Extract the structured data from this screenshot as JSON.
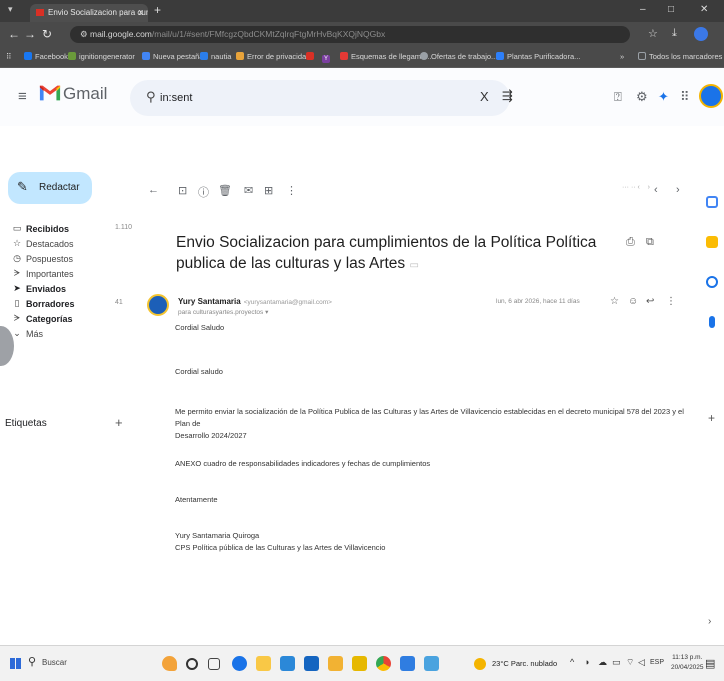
{
  "browser": {
    "tab_title": "Envio Socializacion para cumpl",
    "tab_close": "x",
    "tab_new": "+",
    "url_host": "mail.google.com",
    "url_path": "/mail/u/1/#sent/FMfcgzQbdCKMtZqlrqFtgMrHvBqKXQjNQGbx",
    "window_controls": [
      "–",
      "□",
      "✕"
    ]
  },
  "bookmarks": [
    {
      "label": "Facebook",
      "color": "#1877f2"
    },
    {
      "label": "ignitiongenerator",
      "color": "#6a9a3a"
    },
    {
      "label": "Nueva pestaña",
      "color": "#4285f4"
    },
    {
      "label": "nautia",
      "color": "#2b7de9"
    },
    {
      "label": "Error de privacidad",
      "color": "#e8a33a"
    },
    {
      "label": "",
      "color": "#d93025"
    },
    {
      "label": "Y",
      "color": "#7b3fa0"
    },
    {
      "label": "Esquemas de llegame...",
      "color": "#e53935"
    },
    {
      "label": "Ofertas de trabajo...",
      "color": "#9aa0a6"
    },
    {
      "label": "Plantas Purificadora...",
      "color": "#2d7ff9"
    },
    {
      "label": "Todos los marcadores",
      "color": "#9aa0a6"
    }
  ],
  "gmail": {
    "app_name": "Gmail",
    "search_value": "in:sent",
    "search_clear": "X",
    "compose_label": "Redactar",
    "labels_title": "Etiquetas",
    "labels_add": "+"
  },
  "sidebar": {
    "items": [
      {
        "label": "Recibidos",
        "icon": "inbox-icon",
        "glyph": "▭",
        "count": "1.110",
        "bold": true
      },
      {
        "label": "Destacados",
        "icon": "star-icon",
        "glyph": "☆",
        "count": "",
        "bold": false
      },
      {
        "label": "Pospuestos",
        "icon": "clock-icon",
        "glyph": "◷",
        "count": "",
        "bold": false
      },
      {
        "label": "Importantes",
        "icon": "important-icon",
        "glyph": "ᗒ",
        "count": "",
        "bold": false
      },
      {
        "label": "Enviados",
        "icon": "send-icon",
        "glyph": "➤",
        "count": "",
        "bold": true
      },
      {
        "label": "Borradores",
        "icon": "draft-icon",
        "glyph": "▯",
        "count": "41",
        "bold": true
      },
      {
        "label": "Categorías",
        "icon": "label-icon",
        "glyph": "ᗒ",
        "count": "",
        "bold": true
      },
      {
        "label": "Más",
        "icon": "chevron-down-icon",
        "glyph": "⌄",
        "count": "",
        "bold": false
      }
    ]
  },
  "email": {
    "subject": "Envio Socializacion para cumplimientos de la Política Política publica de las culturas y las Artes",
    "sender_name": "Yury Santamaria",
    "sender_email": "<yurysantamaria@gmail.com>",
    "to_line": "para culturasyartes.proyectos ▾",
    "date": "lun, 6 abr 2026, hace 11 días",
    "body": [
      "Cordial Saludo",
      "Cordial saludo",
      "Me permito enviar la socialización de la Política Publica de las Culturas y las Artes de Villavicencio establecidas en el decreto municipal 578 del 2023 y el Plan de",
      "Desarrollo 2024/2027",
      "ANEXO cuadro de responsabilidades   indicadores y fechas de cumplimientos",
      "Atentamente",
      "Yury Santamaria Quiroga",
      "CPS Política pública de las Culturas y las Artes de Villavicencio"
    ]
  },
  "taskbar": {
    "search_label": "Buscar",
    "weather": "23°C Parc. nublado",
    "language": "ESP",
    "time": "11:13 p.m.",
    "date": "20/04/2025"
  },
  "colors": {
    "compose_bg": "#c2e7ff",
    "gmail_red": "#ea4335",
    "gmail_blue": "#4285f4",
    "gmail_yellow": "#fbbc04",
    "gmail_green": "#34a853"
  }
}
